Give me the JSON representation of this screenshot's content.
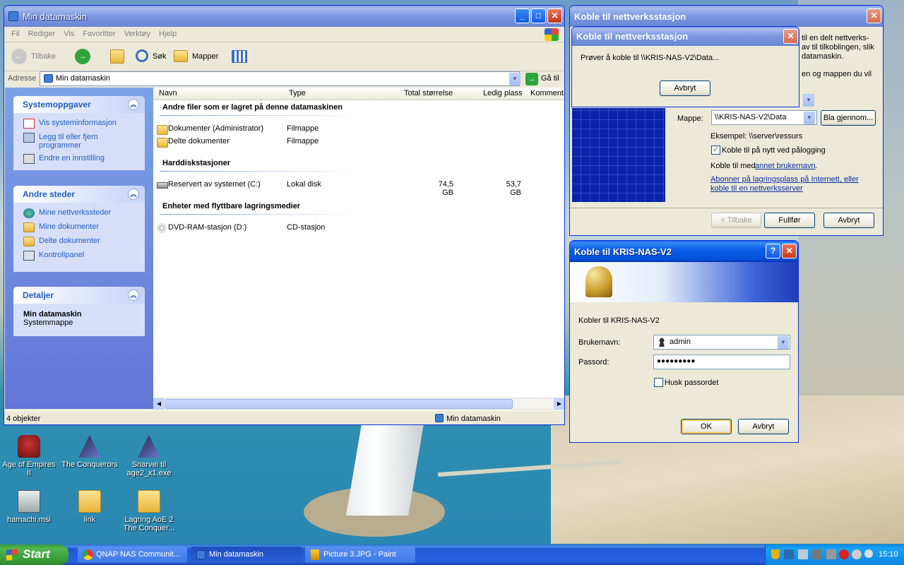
{
  "explorer": {
    "title": "Min datamaskin",
    "menu": [
      "Fil",
      "Rediger",
      "Vis",
      "Favoritter",
      "Verktøy",
      "Hjelp"
    ],
    "toolbar": {
      "back": "Tilbake",
      "search": "Søk",
      "folders": "Mapper"
    },
    "address_label": "Adresse",
    "address_value": "Min datamaskin",
    "go_label": "Gå til",
    "panels": {
      "system": {
        "title": "Systemoppgaver",
        "items": [
          "Vis systeminformasjon",
          "Legg til eller fjern programmer",
          "Endre en innstilling"
        ]
      },
      "other": {
        "title": "Andre steder",
        "items": [
          "Mine nettverkssteder",
          "Mine dokumenter",
          "Delte dokumenter",
          "Kontrollpanel"
        ]
      },
      "details": {
        "title": "Detaljer",
        "name": "Min datamaskin",
        "sub": "Systemmappe"
      }
    },
    "columns": [
      "Navn",
      "Type",
      "Total størrelse",
      "Ledig plass",
      "Kommenta"
    ],
    "sections": [
      {
        "title": "Andre filer som er lagret på denne datamaskinen",
        "rows": [
          {
            "name": "Dokumenter (Administrator)",
            "type": "Filmappe",
            "total": "",
            "free": ""
          },
          {
            "name": "Delte dokumenter",
            "type": "Filmappe",
            "total": "",
            "free": ""
          }
        ]
      },
      {
        "title": "Harddiskstasjoner",
        "rows": [
          {
            "name": "Reservert av systemet (C:)",
            "type": "Lokal disk",
            "total": "74,5 GB",
            "free": "53,7 GB"
          }
        ]
      },
      {
        "title": "Enheter med flyttbare lagringsmedier",
        "rows": [
          {
            "name": "DVD-RAM-stasjon (D:)",
            "type": "CD-stasjon",
            "total": "",
            "free": ""
          }
        ]
      }
    ],
    "status_left": "4 objekter",
    "status_right": "Min datamaskin"
  },
  "map_drive": {
    "title": "Koble til nettverksstasjon",
    "text1": "til en delt nettverks-",
    "text2": "av til tilkoblingen, slik",
    "text3": "datamaskin.",
    "text4": "en og mappen du vil",
    "folder_label": "Mappe:",
    "folder_value": "\\\\KRIS-NAS-V2\\Data",
    "browse_label": "Bla gjennom...",
    "example": "Eksempel: \\\\server\\ressurs",
    "reconnect_label": "Koble til på nytt ved pålogging",
    "connect_as_prefix": "Koble til med ",
    "connect_as_link": "annet brukernavn",
    "subscribe_link": "Abonner på lagringsplass på Internett, eller koble til en nettverksserver",
    "back_label": "< Tilbake",
    "finish_label": "Fullfør",
    "cancel_label": "Avbryt"
  },
  "progress": {
    "title": "Koble til nettverksstasjon",
    "message": "Prøver å koble til \\\\KRIS-NAS-V2\\Data...",
    "cancel_label": "Avbryt"
  },
  "login": {
    "title": "Koble til KRIS-NAS-V2",
    "connecting": "Kobler til KRIS-NAS-V2",
    "user_label": "Brukernavn:",
    "user_value": "admin",
    "pass_label": "Passord:",
    "pass_value": "●●●●●●●●●",
    "remember_label": "Husk passordet",
    "ok_label": "OK",
    "cancel_label": "Avbryt"
  },
  "desktop": [
    {
      "label": "Age of Empires II"
    },
    {
      "label": "The Conquerors"
    },
    {
      "label": "Snarvei til age2_x1.exe"
    },
    {
      "label": "hamachi.msi"
    },
    {
      "label": "link"
    },
    {
      "label": "Lagring AoE 2 The Conquer..."
    }
  ],
  "taskbar": {
    "start": "Start",
    "items": [
      "QNAP NAS Communit...",
      "Min datamaskin",
      "Picture 3.JPG - Paint"
    ],
    "clock": "15:10"
  }
}
